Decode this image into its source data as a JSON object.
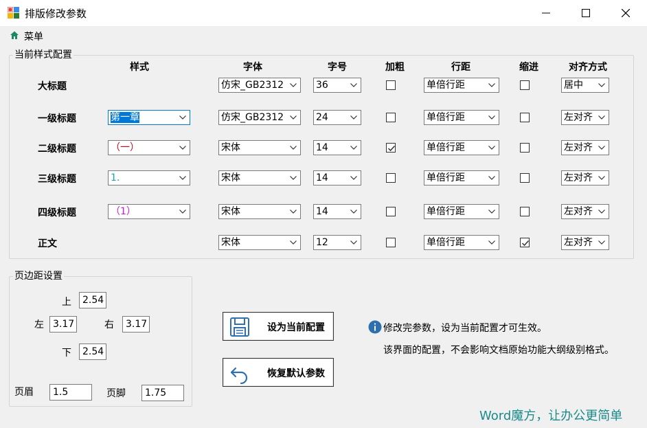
{
  "window": {
    "title": "排版修改参数",
    "minimize": "—",
    "maximize": "☐",
    "close": "✕"
  },
  "menu": {
    "label": "菜单",
    "icon": "home-icon"
  },
  "style_group": {
    "legend": "当前样式配置",
    "headers": {
      "style": "样式",
      "font": "字体",
      "size": "字号",
      "bold": "加粗",
      "spacing": "行距",
      "indent": "缩进",
      "align": "对齐方式"
    },
    "rows": [
      {
        "label": "大标题",
        "style": null,
        "style_color": "#000000",
        "font": "仿宋_GB2312",
        "size": "36",
        "bold": false,
        "spacing": "单倍行距",
        "indent": false,
        "align": "居中"
      },
      {
        "label": "一级标题",
        "style": "第一章",
        "style_color": "#ffffff",
        "font": "仿宋_GB2312",
        "size": "24",
        "bold": false,
        "spacing": "单倍行距",
        "indent": false,
        "align": "左对齐"
      },
      {
        "label": "二级标题",
        "style": "（一）",
        "style_color": "#d0021b",
        "font": "宋体",
        "size": "14",
        "bold": true,
        "spacing": "单倍行距",
        "indent": false,
        "align": "左对齐"
      },
      {
        "label": "三级标题",
        "style": "1.",
        "style_color": "#1aa3b5",
        "font": "宋体",
        "size": "14",
        "bold": false,
        "spacing": "单倍行距",
        "indent": false,
        "align": "左对齐"
      },
      {
        "label": "四级标题",
        "style": "（1）",
        "style_color": "#d21bd2",
        "font": "宋体",
        "size": "14",
        "bold": false,
        "spacing": "单倍行距",
        "indent": false,
        "align": "左对齐"
      },
      {
        "label": "正文",
        "style": null,
        "style_color": "#000000",
        "font": "宋体",
        "size": "12",
        "bold": false,
        "spacing": "单倍行距",
        "indent": true,
        "align": "左对齐"
      }
    ]
  },
  "margin_group": {
    "legend": "页边距设置",
    "top_label": "上",
    "top_value": "2.54",
    "left_label": "左",
    "left_value": "3.17",
    "right_label": "右",
    "right_value": "3.17",
    "bottom_label": "下",
    "bottom_value": "2.54",
    "header_label": "页眉",
    "header_value": "1.5",
    "footer_label": "页脚",
    "footer_value": "1.75"
  },
  "buttons": {
    "set_current": "设为当前配置",
    "restore_default": "恢复默认参数"
  },
  "info": {
    "line1": "修改完参数，设为当前配置才可生效。",
    "line2": "该界面的配置，不会影响文档原始功能大纲级别格式。"
  },
  "brand": {
    "text": "Word魔方，让办公更简单",
    "color": "#1a8a8a"
  },
  "colors": {
    "selection": "#0078d7",
    "icon_blue": "#2e6fb0"
  }
}
